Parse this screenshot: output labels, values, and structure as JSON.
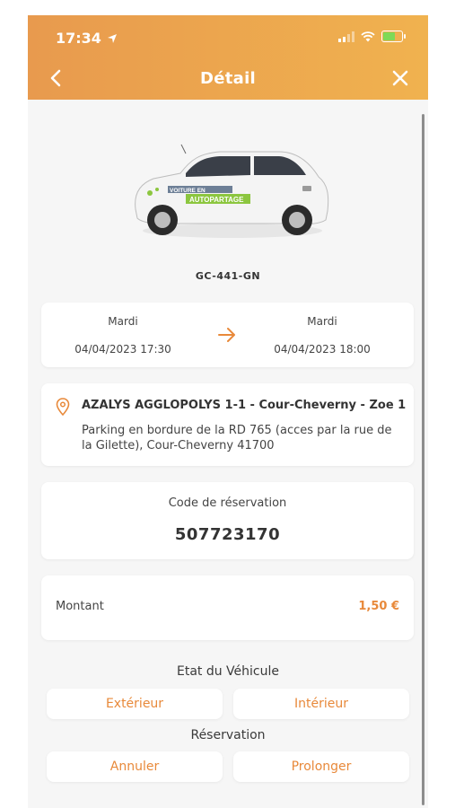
{
  "status": {
    "time": "17:34"
  },
  "nav": {
    "title": "Détail"
  },
  "vehicle": {
    "plate": "GC-441-GN"
  },
  "dates": {
    "start_day": "Mardi",
    "start_datetime": "04/04/2023 17:30",
    "end_day": "Mardi",
    "end_datetime": "04/04/2023 18:00"
  },
  "location": {
    "title": "AZALYS AGGLOPOLYS 1-1 - Cour-Cheverny - Zoe 1",
    "address": "Parking en bordure de la RD 765  (acces par la rue de la Gilette), Cour-Cheverny 41700"
  },
  "reservation_code": {
    "label": "Code de réservation",
    "value": "507723170"
  },
  "amount": {
    "label": "Montant",
    "value": "1,50 €"
  },
  "vehicle_state": {
    "label": "Etat du Véhicule",
    "exterior_button": "Extérieur",
    "interior_button": "Intérieur"
  },
  "reservation": {
    "label": "Réservation",
    "cancel_button": "Annuler",
    "extend_button": "Prolonger"
  },
  "car_decal": {
    "line1": "VOITURE EN",
    "line2": "AUTOPARTAGE"
  },
  "colors": {
    "accent": "#e8893a",
    "header_start": "#e89a4e",
    "header_end": "#f0b24f",
    "background": "#f6f6f6"
  },
  "icons": [
    "location-arrow-icon",
    "signal-icon",
    "wifi-icon",
    "battery-icon",
    "back-chevron-icon",
    "close-icon",
    "arrow-right-icon",
    "map-pin-icon"
  ]
}
